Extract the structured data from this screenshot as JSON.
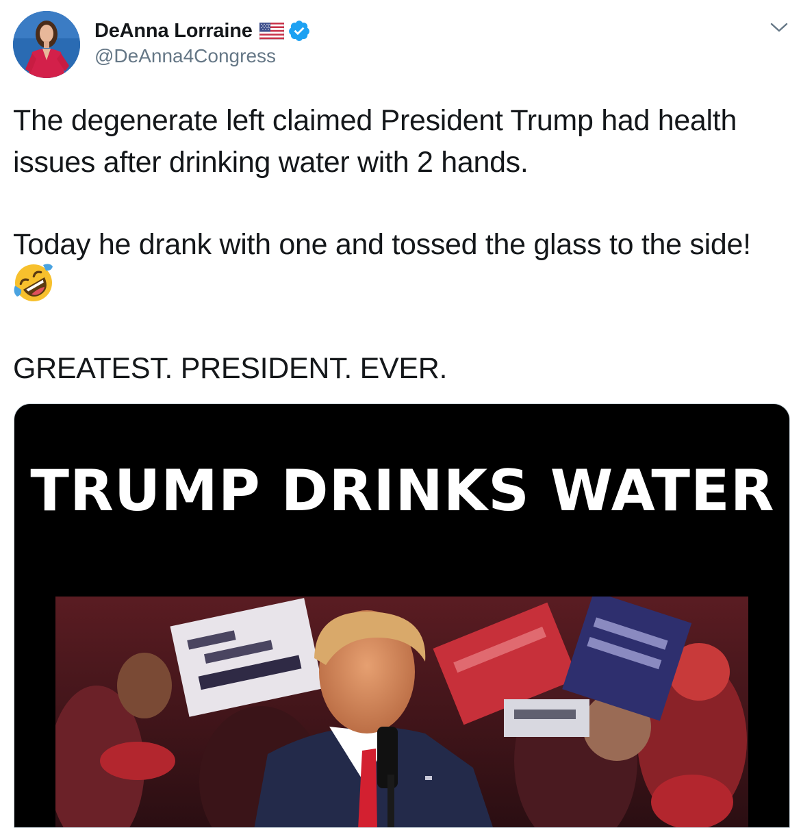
{
  "tweet": {
    "author": {
      "display_name": "DeAnna Lorraine",
      "handle": "@DeAnna4Congress",
      "flag_icon": "us-flag-icon",
      "verified_icon": "verified-badge-icon"
    },
    "menu_icon": "chevron-down-icon",
    "text": {
      "paragraph1": "The degenerate left claimed President Trump had health issues after drinking water with 2 hands.",
      "paragraph2": "Today he drank with one and tossed the glass to the side!",
      "emoji": "rolling-on-floor-laughing-emoji",
      "paragraph3": "GREATEST. PRESIDENT. EVER."
    },
    "media": {
      "title": "TRUMP DRINKS WATER"
    }
  },
  "colors": {
    "text_primary": "#14171a",
    "text_secondary": "#657786",
    "verified_blue": "#1da1f2",
    "media_background": "#000000"
  }
}
